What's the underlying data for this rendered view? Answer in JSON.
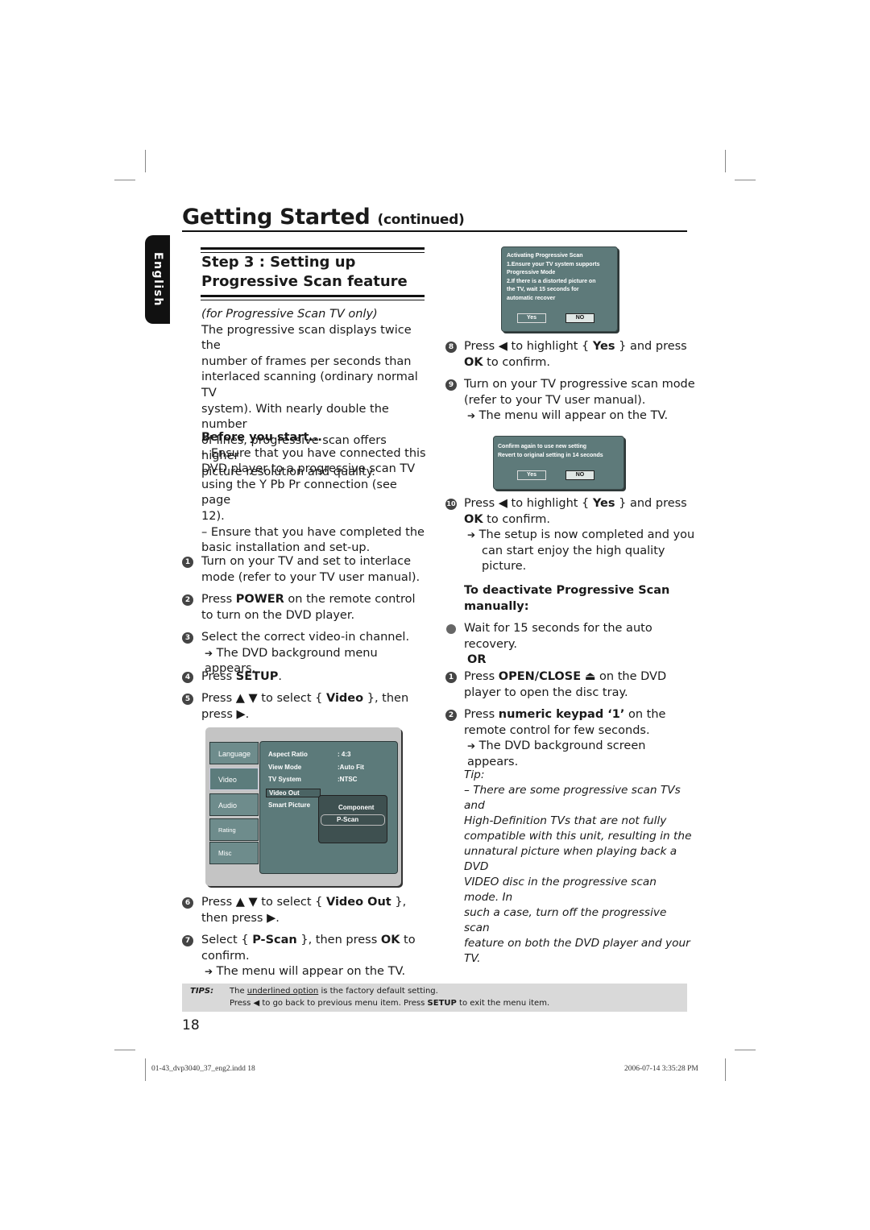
{
  "header": {
    "title": "Getting Started",
    "title_suffix": "(continued)",
    "language_tab": "English"
  },
  "section": {
    "heading_line1": "Step 3 : Setting up",
    "heading_line2": "Progressive Scan feature",
    "subtitle": "(for Progressive Scan TV only)",
    "intro": [
      "The progressive scan displays twice the",
      "number of frames per seconds than",
      "interlaced scanning (ordinary normal TV",
      "system). With nearly double the number",
      "of lines, progressive scan offers higher",
      "picture resolution and quality."
    ],
    "before_heading": "Before you start...",
    "before_items": [
      [
        "– Ensure that you have connected this",
        "DVD player to a progressive scan TV",
        "using the Y Pb Pr connection (see page",
        "12)."
      ],
      [
        "– Ensure that you have completed the",
        "basic installation and set-up."
      ]
    ]
  },
  "steps": {
    "s1": {
      "num": "1",
      "l1": "Turn on your TV and set to interlace",
      "l2": "mode (refer to your TV user manual)."
    },
    "s2": {
      "num": "2",
      "pre": "Press ",
      "bold": "POWER",
      "post": " on the remote control",
      "l2": "to turn on the DVD player."
    },
    "s3": {
      "num": "3",
      "l1": "Select the correct video-in channel.",
      "result": "The DVD background menu appears."
    },
    "s4": {
      "num": "4",
      "pre": "Press ",
      "bold": "SETUP",
      "post": "."
    },
    "s5": {
      "num": "5",
      "pre": "Press ▲ ▼ to select { ",
      "bold": "Video",
      "post": " }, then",
      "l2": "press ▶."
    },
    "s6": {
      "num": "6",
      "pre": "Press ▲ ▼ to select { ",
      "bold": "Video Out",
      "post": " },",
      "l2": "then press ▶."
    },
    "s7": {
      "num": "7",
      "pre": "Select { ",
      "bold": "P-Scan",
      "mid": " }, then press ",
      "bold2": "OK",
      "post": " to",
      "l2": "confirm.",
      "result": "The menu will appear on the TV."
    },
    "s8": {
      "num": "8",
      "pre": "Press ◀ to highlight { ",
      "bold": "Yes",
      "post": " } and press",
      "l2_bold": "OK",
      "l2": " to confirm."
    },
    "s9": {
      "num": "9",
      "l1": "Turn on your TV progressive scan mode",
      "l2": "(refer to your TV user manual).",
      "result": "The menu will appear on the TV."
    },
    "s10": {
      "num": "10",
      "pre": "Press ◀ to highlight { ",
      "bold": "Yes",
      "post": " } and press",
      "l2_bold": "OK",
      "l2": " to confirm.",
      "result": [
        "The setup is now completed and you",
        "can start enjoy the high quality",
        "picture."
      ]
    }
  },
  "deactivate": {
    "heading_l1": "To deactivate Progressive Scan",
    "heading_l2": "manually:",
    "bullet_l1": "Wait for 15 seconds for the auto",
    "bullet_l2": "recovery.",
    "or": "OR",
    "d1": {
      "num": "1",
      "pre": "Press ",
      "bold": "OPEN/CLOSE",
      "eject": "⏏",
      "post": " on the DVD",
      "l2": "player to open the disc tray."
    },
    "d2": {
      "num": "2",
      "pre": "Press ",
      "bold": "numeric keypad ‘1’",
      "post": " on the",
      "l2": "remote control for few seconds.",
      "result": "The DVD background screen appears."
    }
  },
  "tip": {
    "label": "Tip:",
    "lines": [
      "– There are some progressive scan TVs and",
      "High-Definition TVs that are not fully",
      "compatible with this unit, resulting in the",
      "unnatural picture when playing back a DVD",
      "VIDEO disc in the progressive scan mode. In",
      "such a case, turn off the progressive scan",
      "feature on both the DVD player and your TV."
    ]
  },
  "tv_dialog_1": {
    "lines": [
      "Activating Progressive Scan",
      "1.Ensure your TV system supports",
      "Progressive Mode",
      "2.If there is a distorted picture on",
      "the TV, wait 15 seconds for",
      "automatic recover"
    ],
    "yes": "Yes",
    "no": "NO"
  },
  "tv_dialog_2": {
    "lines": [
      "Confirm again to use new setting",
      "Revert to original setting in 14 seconds"
    ],
    "yes": "Yes",
    "no": "NO"
  },
  "setup_menu": {
    "tabs": [
      "Language",
      "Video",
      "Audio",
      "Rating",
      "Misc"
    ],
    "active_tab": "Video",
    "rows": [
      {
        "label": "Aspect Ratio",
        "value": ": 4:3"
      },
      {
        "label": "View Mode",
        "value": ":Auto Fit"
      },
      {
        "label": "TV System",
        "value": ":NTSC"
      },
      {
        "label": "Video Out",
        "value": ""
      },
      {
        "label": "Smart Picture",
        "value": ""
      }
    ],
    "submenu_options": [
      "Component",
      "P-Scan"
    ],
    "submenu_selected": "P-Scan"
  },
  "tips_bar": {
    "label": "TIPS:",
    "line1_pre": "The ",
    "line1_underlined": "underlined option",
    "line1_post": " is the factory default setting.",
    "line2_pre": "Press  ◀ to go back to previous menu item. Press ",
    "line2_bold": "SETUP",
    "line2_post": " to exit the menu item."
  },
  "page_number": "18",
  "footer": {
    "file": "01-43_dvp3040_37_eng2.indd   18",
    "timestamp": "2006-07-14   3:35:28 PM"
  }
}
